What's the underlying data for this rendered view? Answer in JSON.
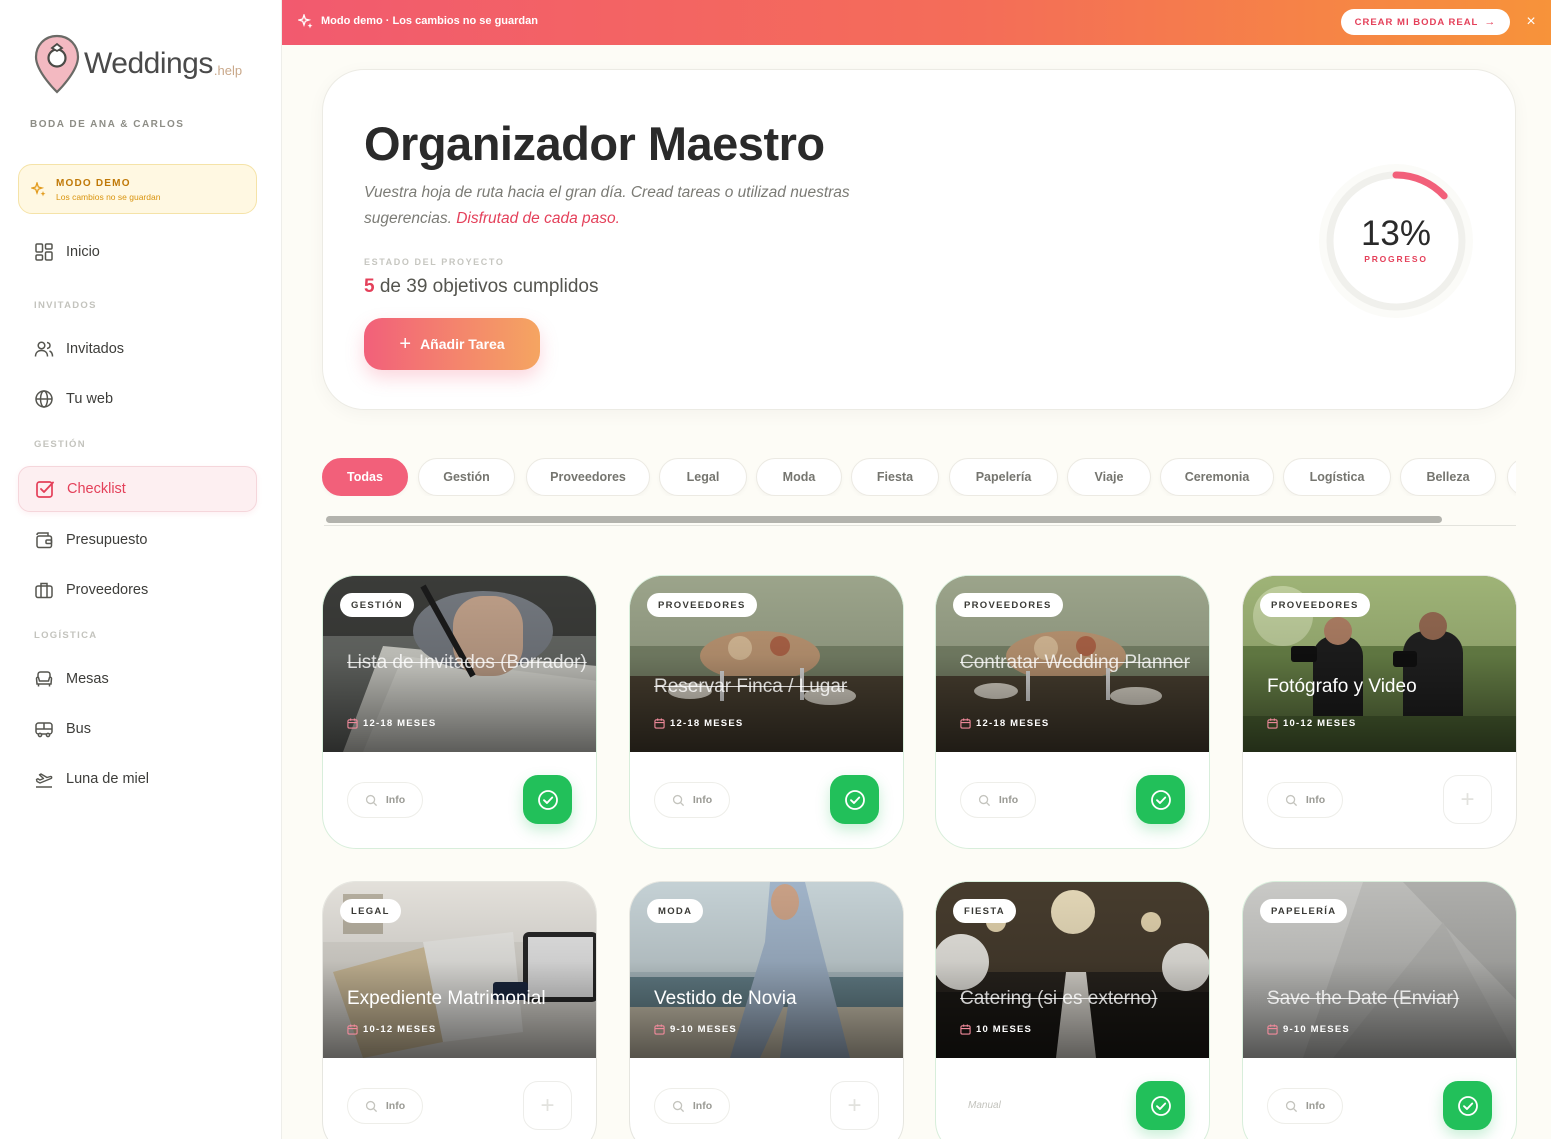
{
  "brand": {
    "name": "Weddings",
    "suffix": ".help"
  },
  "sidebar": {
    "couple": "BODA DE ANA & CARLOS",
    "demo": {
      "title": "MODO DEMO",
      "subtitle": "Los cambios no se guardan"
    },
    "home": "Inicio",
    "sections": {
      "guests": "INVITADOS",
      "management": "GESTIÓN",
      "logistics": "LOGÍSTICA"
    },
    "items": {
      "guests": "Invitados",
      "web": "Tu web",
      "checklist": "Checklist",
      "budget": "Presupuesto",
      "vendors": "Proveedores",
      "tables": "Mesas",
      "bus": "Bus",
      "honeymoon": "Luna de miel"
    }
  },
  "banner": {
    "text": "Modo demo · Los cambios no se guardan",
    "cta": "CREAR MI BODA REAL",
    "close": "×"
  },
  "hero": {
    "title": "Organizador Maestro",
    "description": "Vuestra hoja de ruta hacia el gran día. Cread tareas o utilizad nuestras sugerencias.",
    "highlight": "Disfrutad de cada paso.",
    "state_label": "ESTADO DEL PROYECTO",
    "done_count": "5",
    "done_text": "de 39 objetivos cumplidos",
    "add_button": "Añadir Tarea",
    "progress_value": "13%",
    "progress_label": "PROGRESO",
    "progress_fraction": 0.13
  },
  "filters": [
    "Todas",
    "Gestión",
    "Proveedores",
    "Legal",
    "Moda",
    "Fiesta",
    "Papelería",
    "Viaje",
    "Ceremonia",
    "Logística",
    "Belleza"
  ],
  "cards": [
    {
      "category": "GESTIÓN",
      "title": "Lista de Invitados (Borrador)",
      "time": "12-18 MESES",
      "done": true,
      "info": "Info"
    },
    {
      "category": "PROVEEDORES",
      "title": "Reservar Finca / Lugar",
      "time": "12-18 MESES",
      "done": true,
      "info": "Info"
    },
    {
      "category": "PROVEEDORES",
      "title": "Contratar Wedding Planner",
      "time": "12-18 MESES",
      "done": true,
      "info": "Info"
    },
    {
      "category": "PROVEEDORES",
      "title": "Fotógrafo y Video",
      "time": "10-12 MESES",
      "done": false,
      "info": "Info"
    },
    {
      "category": "LEGAL",
      "title": "Expediente Matrimonial",
      "time": "10-12 MESES",
      "done": false,
      "info": "Info"
    },
    {
      "category": "MODA",
      "title": "Vestido de Novia",
      "time": "9-10 MESES",
      "done": false,
      "info": "Info"
    },
    {
      "category": "FIESTA",
      "title": "Catering (si es externo)",
      "time": "10 MESES",
      "done": true,
      "info": "Manual"
    },
    {
      "category": "PAPELERÍA",
      "title": "Save the Date (Enviar)",
      "time": "9-10 MESES",
      "done": true,
      "info": "Info"
    }
  ],
  "colors": {
    "accent": "#e4405a",
    "success": "#22c05a",
    "demo": "#c07908"
  }
}
